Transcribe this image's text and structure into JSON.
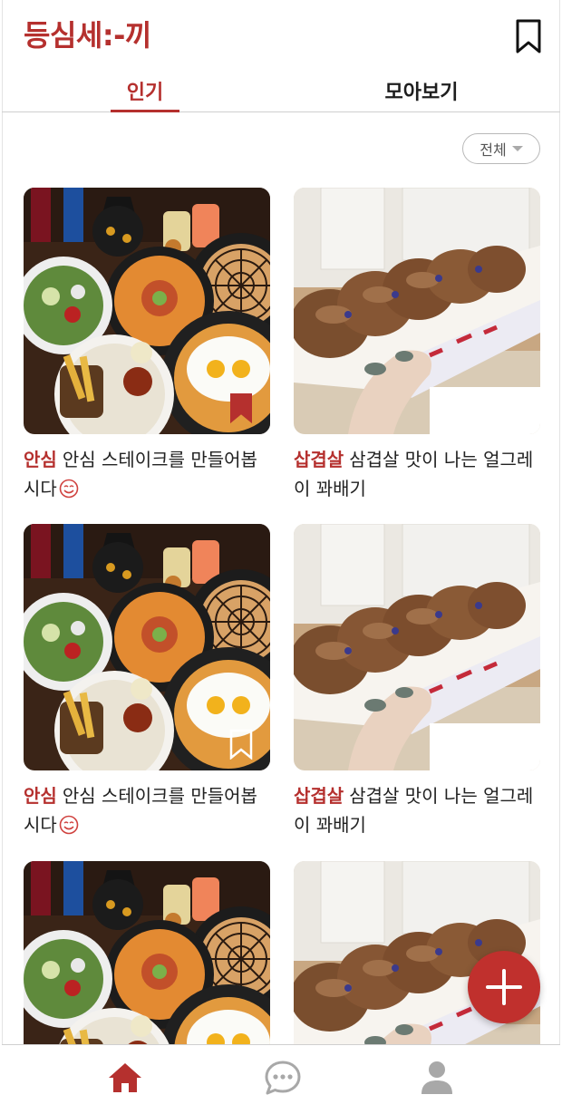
{
  "app": {
    "title": "등심세:-끼",
    "accent_color": "#b5302e",
    "header_icon": "bookmark-outline-icon"
  },
  "tabs": [
    {
      "label": "인기",
      "active": true
    },
    {
      "label": "모아보기",
      "active": false
    }
  ],
  "filter": {
    "selected": "전체",
    "icon": "caret-down-icon"
  },
  "cards": [
    {
      "tag": "안심",
      "title": "안심 스테이크를 만들어봅시다",
      "emoji": "smiling-face-icon",
      "image": "halloween-food-spread-photo",
      "bookmarked": true
    },
    {
      "tag": "삽겹살",
      "title": "삼겹살 맛이 나는 얼그레이 꽈배기",
      "image": "twisted-donut-photo",
      "bookmarked": false
    },
    {
      "tag": "안심",
      "title": "안심 스테이크를 만들어봅시다",
      "emoji": "smiling-face-icon",
      "image": "halloween-food-spread-photo",
      "bookmarked": false
    },
    {
      "tag": "삽겹살",
      "title": "삼겹살 맛이 나는 얼그레이 꽈배기",
      "image": "twisted-donut-photo",
      "bookmarked": false
    },
    {
      "tag": "",
      "title": "",
      "image": "halloween-food-spread-photo",
      "bookmarked": false
    },
    {
      "tag": "",
      "title": "",
      "image": "twisted-donut-photo",
      "bookmarked": false
    }
  ],
  "fab": {
    "icon": "plus-icon"
  },
  "bottom_nav": [
    {
      "icon": "home-icon",
      "active": true
    },
    {
      "icon": "chat-bubble-icon",
      "active": false
    },
    {
      "icon": "user-icon",
      "active": false
    }
  ]
}
